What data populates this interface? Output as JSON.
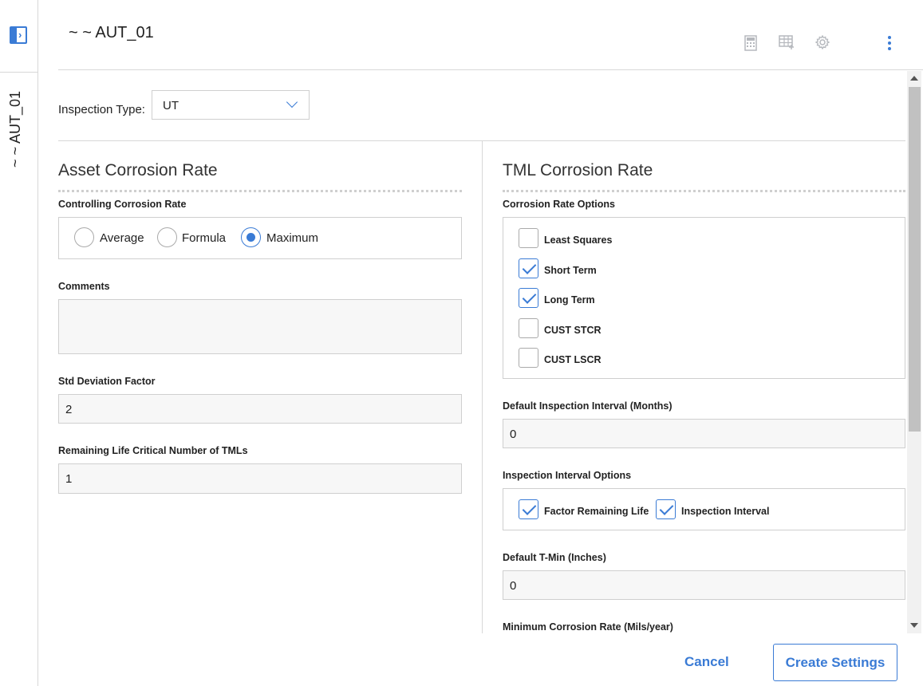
{
  "sidebar": {
    "label": "~ ~ AUT_01"
  },
  "header": {
    "title": "~ ~ AUT_01",
    "icons": [
      "calculator-icon",
      "table-add-icon",
      "gear-icon",
      "kebab-menu-icon"
    ]
  },
  "inspection": {
    "label": "Inspection Type:",
    "value": "UT"
  },
  "asset": {
    "title": "Asset Corrosion Rate",
    "controlling_label": "Controlling Corrosion Rate",
    "radios": [
      {
        "label": "Average",
        "selected": false
      },
      {
        "label": "Formula",
        "selected": false
      },
      {
        "label": "Maximum",
        "selected": true
      }
    ],
    "comments_label": "Comments",
    "comments_value": "",
    "std_label": "Std Deviation Factor",
    "std_value": "2",
    "rl_label": "Remaining Life Critical Number of TMLs",
    "rl_value": "1"
  },
  "tml": {
    "title": "TML Corrosion Rate",
    "options_label": "Corrosion Rate Options",
    "options": [
      {
        "label": "Least Squares",
        "checked": false
      },
      {
        "label": "Short Term",
        "checked": true
      },
      {
        "label": "Long Term",
        "checked": true
      },
      {
        "label": "CUST STCR",
        "checked": false
      },
      {
        "label": "CUST LSCR",
        "checked": false
      }
    ],
    "interval_label": "Default Inspection Interval (Months)",
    "interval_value": "0",
    "interval_opts_label": "Inspection Interval Options",
    "interval_opts": [
      {
        "label": "Factor Remaining Life",
        "checked": true
      },
      {
        "label": "Inspection Interval",
        "checked": true
      }
    ],
    "tmin_label": "Default T-Min (Inches)",
    "tmin_value": "0",
    "mincr_label": "Minimum Corrosion Rate (Mils/year)"
  },
  "footer": {
    "cancel": "Cancel",
    "create": "Create Settings"
  },
  "colors": {
    "accent": "#3a7bd5",
    "border": "#cfcfcf",
    "icon_gray": "#b5b8bd"
  }
}
